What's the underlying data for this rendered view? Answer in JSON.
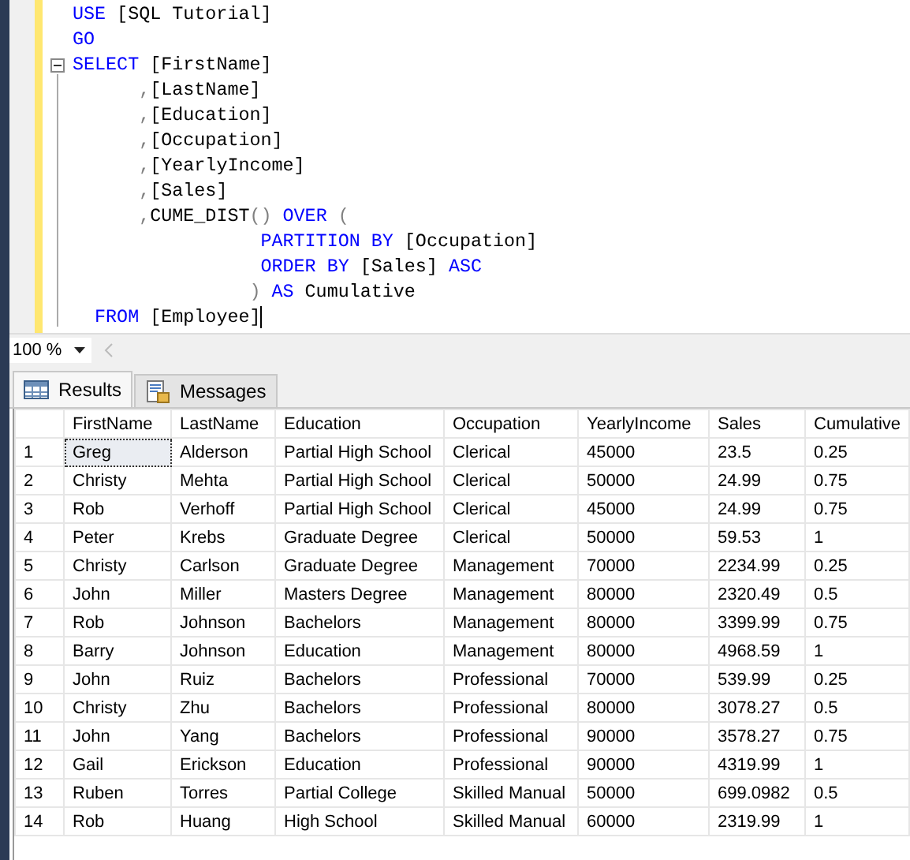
{
  "editor": {
    "lines": [
      [
        {
          "text": "USE",
          "kind": "keyword"
        },
        {
          "text": " [SQL Tutorial]",
          "kind": "plain"
        }
      ],
      [
        {
          "text": "GO",
          "kind": "keyword"
        }
      ],
      [
        {
          "text": "SELECT",
          "kind": "keyword"
        },
        {
          "text": " [FirstName]",
          "kind": "plain"
        }
      ],
      [
        {
          "text": "      ,",
          "kind": "punct"
        },
        {
          "text": "[LastName]",
          "kind": "plain"
        }
      ],
      [
        {
          "text": "      ,",
          "kind": "punct"
        },
        {
          "text": "[Education]",
          "kind": "plain"
        }
      ],
      [
        {
          "text": "      ,",
          "kind": "punct"
        },
        {
          "text": "[Occupation]",
          "kind": "plain"
        }
      ],
      [
        {
          "text": "      ,",
          "kind": "punct"
        },
        {
          "text": "[YearlyIncome]",
          "kind": "plain"
        }
      ],
      [
        {
          "text": "      ,",
          "kind": "punct"
        },
        {
          "text": "[Sales]",
          "kind": "plain"
        }
      ],
      [
        {
          "text": "      ,",
          "kind": "punct"
        },
        {
          "text": "CUME_DIST",
          "kind": "plain"
        },
        {
          "text": "()",
          "kind": "punct"
        },
        {
          "text": " OVER",
          "kind": "keyword"
        },
        {
          "text": " (",
          "kind": "punct"
        }
      ],
      [
        {
          "text": "                 PARTITION BY",
          "kind": "keyword"
        },
        {
          "text": " [Occupation]",
          "kind": "plain"
        }
      ],
      [
        {
          "text": "                 ORDER BY",
          "kind": "keyword"
        },
        {
          "text": " [Sales]",
          "kind": "plain"
        },
        {
          "text": " ASC",
          "kind": "keyword"
        }
      ],
      [
        {
          "text": "                )",
          "kind": "punct"
        },
        {
          "text": " AS",
          "kind": "keyword"
        },
        {
          "text": " Cumulative",
          "kind": "plain"
        }
      ],
      [
        {
          "text": "  FROM",
          "kind": "keyword"
        },
        {
          "text": " [Employee]",
          "kind": "plain"
        }
      ]
    ]
  },
  "zoom": {
    "value": "100 %"
  },
  "tabs": [
    {
      "label": "Results",
      "selected": true
    },
    {
      "label": "Messages",
      "selected": false
    }
  ],
  "table": {
    "columns": [
      "FirstName",
      "LastName",
      "Education",
      "Occupation",
      "YearlyIncome",
      "Sales",
      "Cumulative"
    ],
    "rows": [
      {
        "number": "1",
        "cells": [
          {
            "text": "Greg",
            "selected": true
          },
          {
            "text": "Alderson",
            "selected": false
          },
          {
            "text": "Partial High School",
            "selected": false
          },
          {
            "text": "Clerical",
            "selected": false
          },
          {
            "text": "45000",
            "selected": false
          },
          {
            "text": "23.5",
            "selected": false
          },
          {
            "text": "0.25",
            "selected": false
          }
        ]
      },
      {
        "number": "2",
        "cells": [
          {
            "text": "Christy",
            "selected": false
          },
          {
            "text": "Mehta",
            "selected": false
          },
          {
            "text": "Partial High School",
            "selected": false
          },
          {
            "text": "Clerical",
            "selected": false
          },
          {
            "text": "50000",
            "selected": false
          },
          {
            "text": "24.99",
            "selected": false
          },
          {
            "text": "0.75",
            "selected": false
          }
        ]
      },
      {
        "number": "3",
        "cells": [
          {
            "text": "Rob",
            "selected": false
          },
          {
            "text": "Verhoff",
            "selected": false
          },
          {
            "text": "Partial High School",
            "selected": false
          },
          {
            "text": "Clerical",
            "selected": false
          },
          {
            "text": "45000",
            "selected": false
          },
          {
            "text": "24.99",
            "selected": false
          },
          {
            "text": "0.75",
            "selected": false
          }
        ]
      },
      {
        "number": "4",
        "cells": [
          {
            "text": "Peter",
            "selected": false
          },
          {
            "text": "Krebs",
            "selected": false
          },
          {
            "text": "Graduate Degree",
            "selected": false
          },
          {
            "text": "Clerical",
            "selected": false
          },
          {
            "text": "50000",
            "selected": false
          },
          {
            "text": "59.53",
            "selected": false
          },
          {
            "text": "1",
            "selected": false
          }
        ]
      },
      {
        "number": "5",
        "cells": [
          {
            "text": "Christy",
            "selected": false
          },
          {
            "text": "Carlson",
            "selected": false
          },
          {
            "text": "Graduate Degree",
            "selected": false
          },
          {
            "text": "Management",
            "selected": false
          },
          {
            "text": "70000",
            "selected": false
          },
          {
            "text": "2234.99",
            "selected": false
          },
          {
            "text": "0.25",
            "selected": false
          }
        ]
      },
      {
        "number": "6",
        "cells": [
          {
            "text": "John",
            "selected": false
          },
          {
            "text": "Miller",
            "selected": false
          },
          {
            "text": "Masters Degree",
            "selected": false
          },
          {
            "text": "Management",
            "selected": false
          },
          {
            "text": "80000",
            "selected": false
          },
          {
            "text": "2320.49",
            "selected": false
          },
          {
            "text": "0.5",
            "selected": false
          }
        ]
      },
      {
        "number": "7",
        "cells": [
          {
            "text": "Rob",
            "selected": false
          },
          {
            "text": "Johnson",
            "selected": false
          },
          {
            "text": "Bachelors",
            "selected": false
          },
          {
            "text": "Management",
            "selected": false
          },
          {
            "text": "80000",
            "selected": false
          },
          {
            "text": "3399.99",
            "selected": false
          },
          {
            "text": "0.75",
            "selected": false
          }
        ]
      },
      {
        "number": "8",
        "cells": [
          {
            "text": "Barry",
            "selected": false
          },
          {
            "text": "Johnson",
            "selected": false
          },
          {
            "text": "Education",
            "selected": false
          },
          {
            "text": "Management",
            "selected": false
          },
          {
            "text": "80000",
            "selected": false
          },
          {
            "text": "4968.59",
            "selected": false
          },
          {
            "text": "1",
            "selected": false
          }
        ]
      },
      {
        "number": "9",
        "cells": [
          {
            "text": "John",
            "selected": false
          },
          {
            "text": "Ruiz",
            "selected": false
          },
          {
            "text": "Bachelors",
            "selected": false
          },
          {
            "text": "Professional",
            "selected": false
          },
          {
            "text": "70000",
            "selected": false
          },
          {
            "text": "539.99",
            "selected": false
          },
          {
            "text": "0.25",
            "selected": false
          }
        ]
      },
      {
        "number": "10",
        "cells": [
          {
            "text": "Christy",
            "selected": false
          },
          {
            "text": "Zhu",
            "selected": false
          },
          {
            "text": "Bachelors",
            "selected": false
          },
          {
            "text": "Professional",
            "selected": false
          },
          {
            "text": "80000",
            "selected": false
          },
          {
            "text": "3078.27",
            "selected": false
          },
          {
            "text": "0.5",
            "selected": false
          }
        ]
      },
      {
        "number": "11",
        "cells": [
          {
            "text": "John",
            "selected": false
          },
          {
            "text": "Yang",
            "selected": false
          },
          {
            "text": "Bachelors",
            "selected": false
          },
          {
            "text": "Professional",
            "selected": false
          },
          {
            "text": "90000",
            "selected": false
          },
          {
            "text": "3578.27",
            "selected": false
          },
          {
            "text": "0.75",
            "selected": false
          }
        ]
      },
      {
        "number": "12",
        "cells": [
          {
            "text": "Gail",
            "selected": false
          },
          {
            "text": "Erickson",
            "selected": false
          },
          {
            "text": "Education",
            "selected": false
          },
          {
            "text": "Professional",
            "selected": false
          },
          {
            "text": "90000",
            "selected": false
          },
          {
            "text": "4319.99",
            "selected": false
          },
          {
            "text": "1",
            "selected": false
          }
        ]
      },
      {
        "number": "13",
        "cells": [
          {
            "text": "Ruben",
            "selected": false
          },
          {
            "text": "Torres",
            "selected": false
          },
          {
            "text": "Partial College",
            "selected": false
          },
          {
            "text": "Skilled Manual",
            "selected": false
          },
          {
            "text": "50000",
            "selected": false
          },
          {
            "text": "699.0982",
            "selected": false
          },
          {
            "text": "0.5",
            "selected": false
          }
        ]
      },
      {
        "number": "14",
        "cells": [
          {
            "text": "Rob",
            "selected": false
          },
          {
            "text": "Huang",
            "selected": false
          },
          {
            "text": "High School",
            "selected": false
          },
          {
            "text": "Skilled Manual",
            "selected": false
          },
          {
            "text": "60000",
            "selected": false
          },
          {
            "text": "2319.99",
            "selected": false
          },
          {
            "text": "1",
            "selected": false
          }
        ]
      }
    ]
  }
}
